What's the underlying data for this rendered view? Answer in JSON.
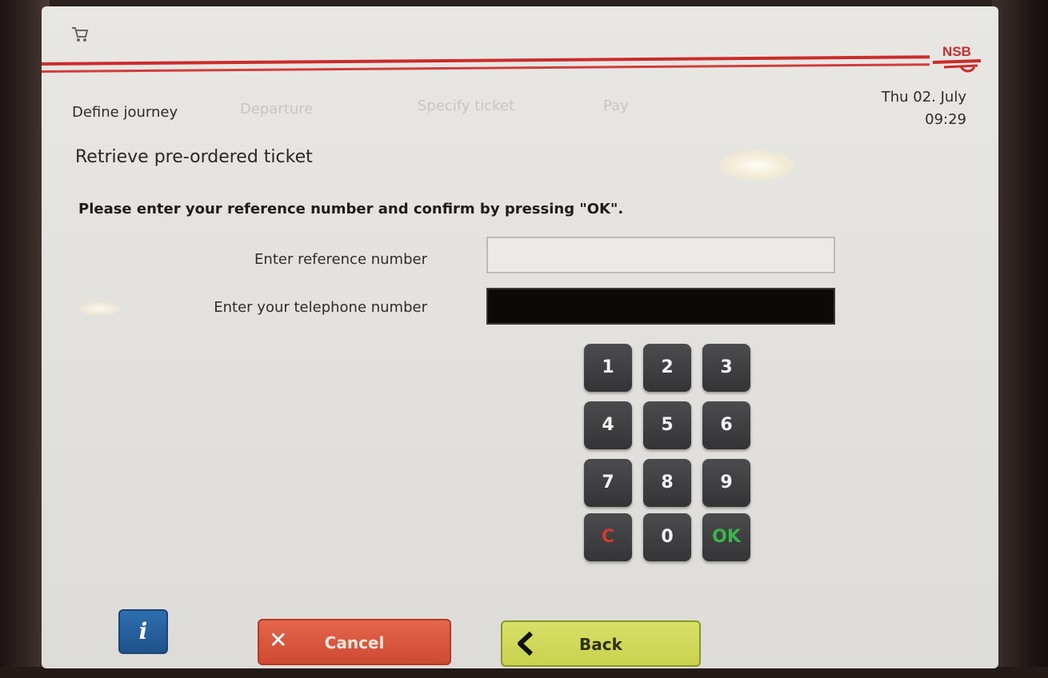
{
  "header": {
    "brand": "NSB",
    "date": "Thu 02. July",
    "time": "09:29"
  },
  "steps": [
    {
      "label": "Define journey",
      "active": true
    },
    {
      "label": "Departure",
      "active": false
    },
    {
      "label": "Specify ticket",
      "active": false
    },
    {
      "label": "Pay",
      "active": false
    }
  ],
  "page": {
    "title": "Retrieve pre-ordered ticket",
    "instruction": "Please enter your reference number and confirm by pressing \"OK\"."
  },
  "form": {
    "reference_label": "Enter reference number",
    "reference_value": "",
    "telephone_label": "Enter your telephone number",
    "telephone_value": ""
  },
  "keypad": [
    "1",
    "2",
    "3",
    "4",
    "5",
    "6",
    "7",
    "8",
    "9",
    "C",
    "0",
    "OK"
  ],
  "buttons": {
    "info": "i",
    "cancel": "Cancel",
    "back": "Back"
  },
  "colors": {
    "accent_red": "#cc2b2b",
    "cancel": "#d9553c",
    "back": "#d0d85a",
    "info": "#2a64a2",
    "ok_green": "#39b54a",
    "clear_red": "#d33b2e"
  }
}
